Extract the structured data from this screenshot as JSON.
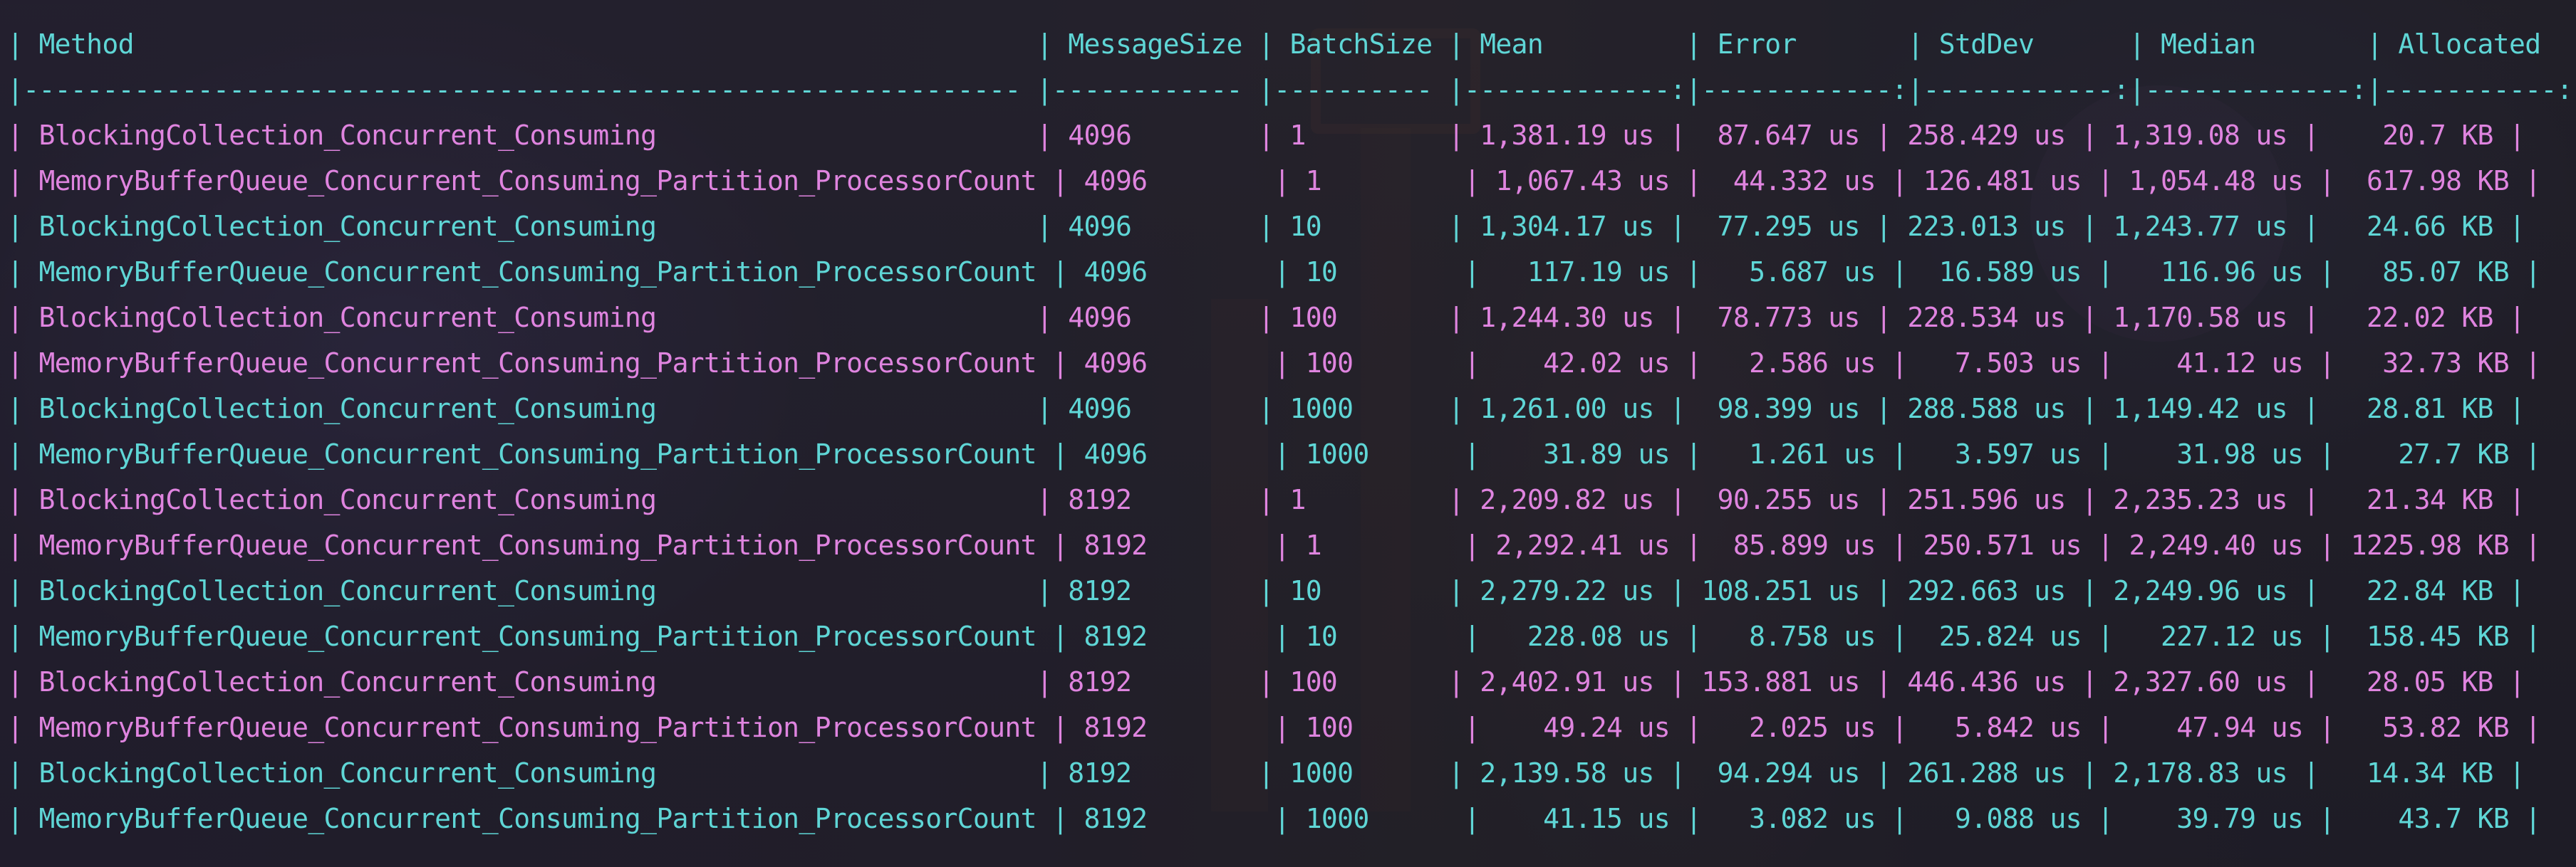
{
  "terminal": {
    "colors": {
      "cyan": "#5fd6d6",
      "pink": "#df84df"
    }
  },
  "table": {
    "header_line": "| Method                                                         | MessageSize | BatchSize | Mean         | Error       | StdDev      | Median       | Allocated  |",
    "separator_line": "|--------------------------------------------------------------- |------------ |---------- |-------------:|------------:|------------:|-------------:|-----------:|",
    "columns": [
      "Method",
      "MessageSize",
      "BatchSize",
      "Mean",
      "Error",
      "StdDev",
      "Median",
      "Allocated"
    ],
    "rows": [
      {
        "color": "pink",
        "line": "| BlockingCollection_Concurrent_Consuming                        | 4096        | 1         | 1,381.19 us |  87.647 us | 258.429 us | 1,319.08 us |    20.7 KB |"
      },
      {
        "color": "pink",
        "line": "| MemoryBufferQueue_Concurrent_Consuming_Partition_ProcessorCount | 4096        | 1         | 1,067.43 us |  44.332 us | 126.481 us | 1,054.48 us |  617.98 KB |"
      },
      {
        "color": "cyan",
        "line": "| BlockingCollection_Concurrent_Consuming                        | 4096        | 10        | 1,304.17 us |  77.295 us | 223.013 us | 1,243.77 us |   24.66 KB |"
      },
      {
        "color": "cyan",
        "line": "| MemoryBufferQueue_Concurrent_Consuming_Partition_ProcessorCount | 4096        | 10        |   117.19 us |   5.687 us |  16.589 us |   116.96 us |   85.07 KB |"
      },
      {
        "color": "pink",
        "line": "| BlockingCollection_Concurrent_Consuming                        | 4096        | 100       | 1,244.30 us |  78.773 us | 228.534 us | 1,170.58 us |   22.02 KB |"
      },
      {
        "color": "pink",
        "line": "| MemoryBufferQueue_Concurrent_Consuming_Partition_ProcessorCount | 4096        | 100       |    42.02 us |   2.586 us |   7.503 us |    41.12 us |   32.73 KB |"
      },
      {
        "color": "cyan",
        "line": "| BlockingCollection_Concurrent_Consuming                        | 4096        | 1000      | 1,261.00 us |  98.399 us | 288.588 us | 1,149.42 us |   28.81 KB |"
      },
      {
        "color": "cyan",
        "line": "| MemoryBufferQueue_Concurrent_Consuming_Partition_ProcessorCount | 4096        | 1000      |    31.89 us |   1.261 us |   3.597 us |    31.98 us |    27.7 KB |"
      },
      {
        "color": "pink",
        "line": "| BlockingCollection_Concurrent_Consuming                        | 8192        | 1         | 2,209.82 us |  90.255 us | 251.596 us | 2,235.23 us |   21.34 KB |"
      },
      {
        "color": "pink",
        "line": "| MemoryBufferQueue_Concurrent_Consuming_Partition_ProcessorCount | 8192        | 1         | 2,292.41 us |  85.899 us | 250.571 us | 2,249.40 us | 1225.98 KB |"
      },
      {
        "color": "cyan",
        "line": "| BlockingCollection_Concurrent_Consuming                        | 8192        | 10        | 2,279.22 us | 108.251 us | 292.663 us | 2,249.96 us |   22.84 KB |"
      },
      {
        "color": "cyan",
        "line": "| MemoryBufferQueue_Concurrent_Consuming_Partition_ProcessorCount | 8192        | 10        |   228.08 us |   8.758 us |  25.824 us |   227.12 us |  158.45 KB |"
      },
      {
        "color": "pink",
        "line": "| BlockingCollection_Concurrent_Consuming                        | 8192        | 100       | 2,402.91 us | 153.881 us | 446.436 us | 2,327.60 us |   28.05 KB |"
      },
      {
        "color": "pink",
        "line": "| MemoryBufferQueue_Concurrent_Consuming_Partition_ProcessorCount | 8192        | 100       |    49.24 us |   2.025 us |   5.842 us |    47.94 us |   53.82 KB |"
      },
      {
        "color": "cyan",
        "line": "| BlockingCollection_Concurrent_Consuming                        | 8192        | 1000      | 2,139.58 us |  94.294 us | 261.288 us | 2,178.83 us |   14.34 KB |"
      },
      {
        "color": "cyan",
        "line": "| MemoryBufferQueue_Concurrent_Consuming_Partition_ProcessorCount | 8192        | 1000      |    41.15 us |   3.082 us |   9.088 us |    39.79 us |    43.7 KB |"
      }
    ]
  }
}
